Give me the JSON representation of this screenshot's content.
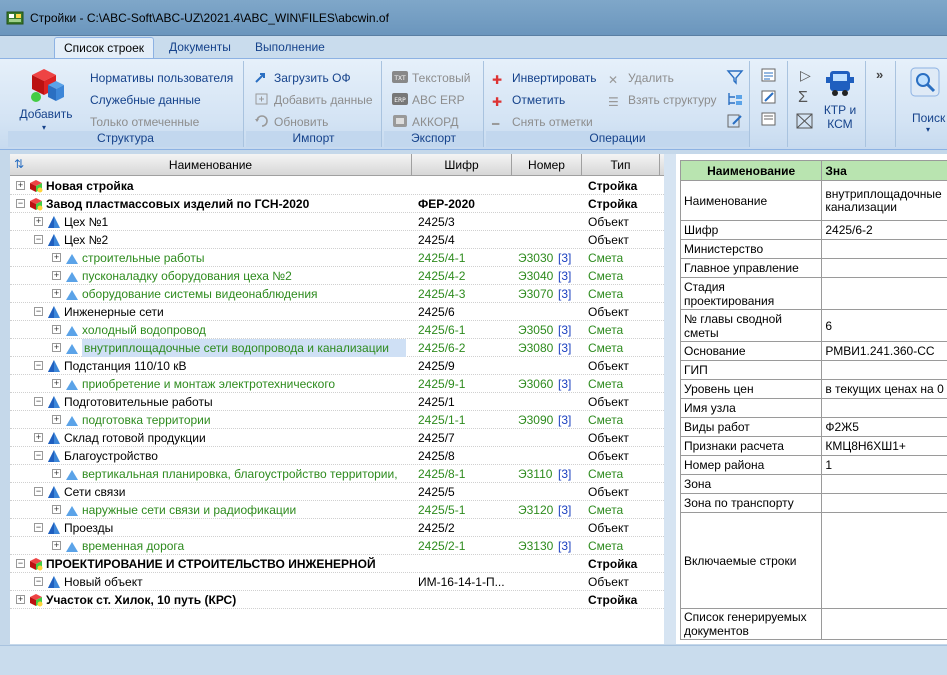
{
  "window": {
    "title": "Стройки - C:\\ABC-Soft\\ABC-UZ\\2021.4\\ABC_WIN\\FILES\\abcwin.of"
  },
  "tabs": [
    {
      "label": "Список строек",
      "active": true
    },
    {
      "label": "Документы"
    },
    {
      "label": "Выполнение"
    }
  ],
  "ribbon": {
    "structure": {
      "label": "Структура",
      "add_label": "Добавить",
      "items": [
        "Нормативы пользователя",
        "Служебные данные",
        "Только отмеченные"
      ]
    },
    "import": {
      "label": "Импорт",
      "items": [
        "Загрузить ОФ",
        "Добавить данные",
        "Обновить"
      ]
    },
    "export": {
      "label": "Экспорт",
      "items": [
        "Текстовый",
        "ABC ERP",
        "АККОРД"
      ]
    },
    "operations": {
      "label": "Операции",
      "items": [
        "Инвертировать",
        "Отметить",
        "Снять отметки",
        "Удалить",
        "Взять структуру"
      ]
    },
    "ktm_label": "КТР и КСМ",
    "search_label": "Поиск"
  },
  "tree": {
    "headers": [
      "Наименование",
      "Шифр",
      "Номер",
      "Тип"
    ],
    "rows": [
      {
        "name": "Новая стройка",
        "code": "",
        "num": "",
        "badge": "",
        "type": "Стройка"
      },
      {
        "name": "Завод пластмассовых изделий по ГСН-2020",
        "code": "ФЕР-2020",
        "num": "",
        "badge": "",
        "type": "Стройка"
      },
      {
        "name": "Цех №1",
        "code": "2425/3",
        "num": "",
        "badge": "",
        "type": "Объект"
      },
      {
        "name": "Цех №2",
        "code": "2425/4",
        "num": "",
        "badge": "",
        "type": "Объект"
      },
      {
        "name": "строительные работы",
        "code": "2425/4-1",
        "num": "Э3030",
        "badge": "[3]",
        "type": "Смета"
      },
      {
        "name": "пусконаладку оборудования цеха №2",
        "code": "2425/4-2",
        "num": "Э3040",
        "badge": "[3]",
        "type": "Смета"
      },
      {
        "name": "оборудование системы видеонаблюдения",
        "code": "2425/4-3",
        "num": "Э3070",
        "badge": "[3]",
        "type": "Смета"
      },
      {
        "name": "Инженерные сети",
        "code": "2425/6",
        "num": "",
        "badge": "",
        "type": "Объект"
      },
      {
        "name": "холодный водопровод",
        "code": "2425/6-1",
        "num": "Э3050",
        "badge": "[3]",
        "type": "Смета"
      },
      {
        "name": "внутриплощадочные сети водопровода и канализации",
        "code": "2425/6-2",
        "num": "Э3080",
        "badge": "[3]",
        "type": "Смета"
      },
      {
        "name": "Подстанция 110/10 кВ",
        "code": "2425/9",
        "num": "",
        "badge": "",
        "type": "Объект"
      },
      {
        "name": "приобретение и монтаж электротехнического",
        "code": "2425/9-1",
        "num": "Э3060",
        "badge": "[3]",
        "type": "Смета"
      },
      {
        "name": "Подготовительные работы",
        "code": "2425/1",
        "num": "",
        "badge": "",
        "type": "Объект"
      },
      {
        "name": "подготовка территории",
        "code": "2425/1-1",
        "num": "Э3090",
        "badge": "[3]",
        "type": "Смета"
      },
      {
        "name": "Склад готовой продукции",
        "code": "2425/7",
        "num": "",
        "badge": "",
        "type": "Объект"
      },
      {
        "name": "Благоустройство",
        "code": "2425/8",
        "num": "",
        "badge": "",
        "type": "Объект"
      },
      {
        "name": "вертикальная планировка, благоустройство территории,",
        "code": "2425/8-1",
        "num": "Э3110",
        "badge": "[3]",
        "type": "Смета"
      },
      {
        "name": "Сети связи",
        "code": "2425/5",
        "num": "",
        "badge": "",
        "type": "Объект"
      },
      {
        "name": "наружные сети связи и радиофикации",
        "code": "2425/5-1",
        "num": "Э3120",
        "badge": "[3]",
        "type": "Смета"
      },
      {
        "name": "Проезды",
        "code": "2425/2",
        "num": "",
        "badge": "",
        "type": "Объект"
      },
      {
        "name": "временная дорога",
        "code": "2425/2-1",
        "num": "Э3130",
        "badge": "[3]",
        "type": "Смета"
      },
      {
        "name": "ПРОЕКТИРОВАНИЕ И СТРОИТЕЛЬСТВО ИНЖЕНЕРНОЙ",
        "code": "",
        "num": "",
        "badge": "",
        "type": "Стройка"
      },
      {
        "name": "Новый объект",
        "code": "ИМ-16-14-1-П...",
        "num": "",
        "badge": "",
        "type": "Объект"
      },
      {
        "name": "Участок ст. Хилок, 10 путь (КРС)",
        "code": "",
        "num": "",
        "badge": "",
        "type": "Стройка"
      }
    ]
  },
  "props": {
    "headers": [
      "Наименование",
      "Зна"
    ],
    "rows": [
      {
        "label": "Наименование",
        "value": "внутриплощадочные канализации"
      },
      {
        "label": "Шифр",
        "value": "2425/6-2"
      },
      {
        "label": "Министерство",
        "value": ""
      },
      {
        "label": "Главное управление",
        "value": ""
      },
      {
        "label": "Стадия проектирования",
        "value": ""
      },
      {
        "label": "№ главы сводной сметы",
        "value": "6"
      },
      {
        "label": "Основание",
        "value": "РМВИ1.241.360-СС"
      },
      {
        "label": "ГИП",
        "value": ""
      },
      {
        "label": "Уровень цен",
        "value": "в текущих ценах на 0"
      },
      {
        "label": "Имя узла",
        "value": ""
      },
      {
        "label": "Виды работ",
        "value": "Ф2Ж5"
      },
      {
        "label": "Признаки расчета",
        "value": "КМЦ8Н6ХШ1+"
      },
      {
        "label": "Номер района",
        "value": "1"
      },
      {
        "label": "Зона",
        "value": ""
      },
      {
        "label": "Зона по транспорту",
        "value": ""
      },
      {
        "label": "Включаемые строки",
        "value": ""
      },
      {
        "label": "Список генерируемых документов",
        "value": ""
      }
    ]
  },
  "colors": {
    "accent": "#15428b",
    "green_text": "#2e8b1e",
    "selection": "#cfe0f5"
  }
}
